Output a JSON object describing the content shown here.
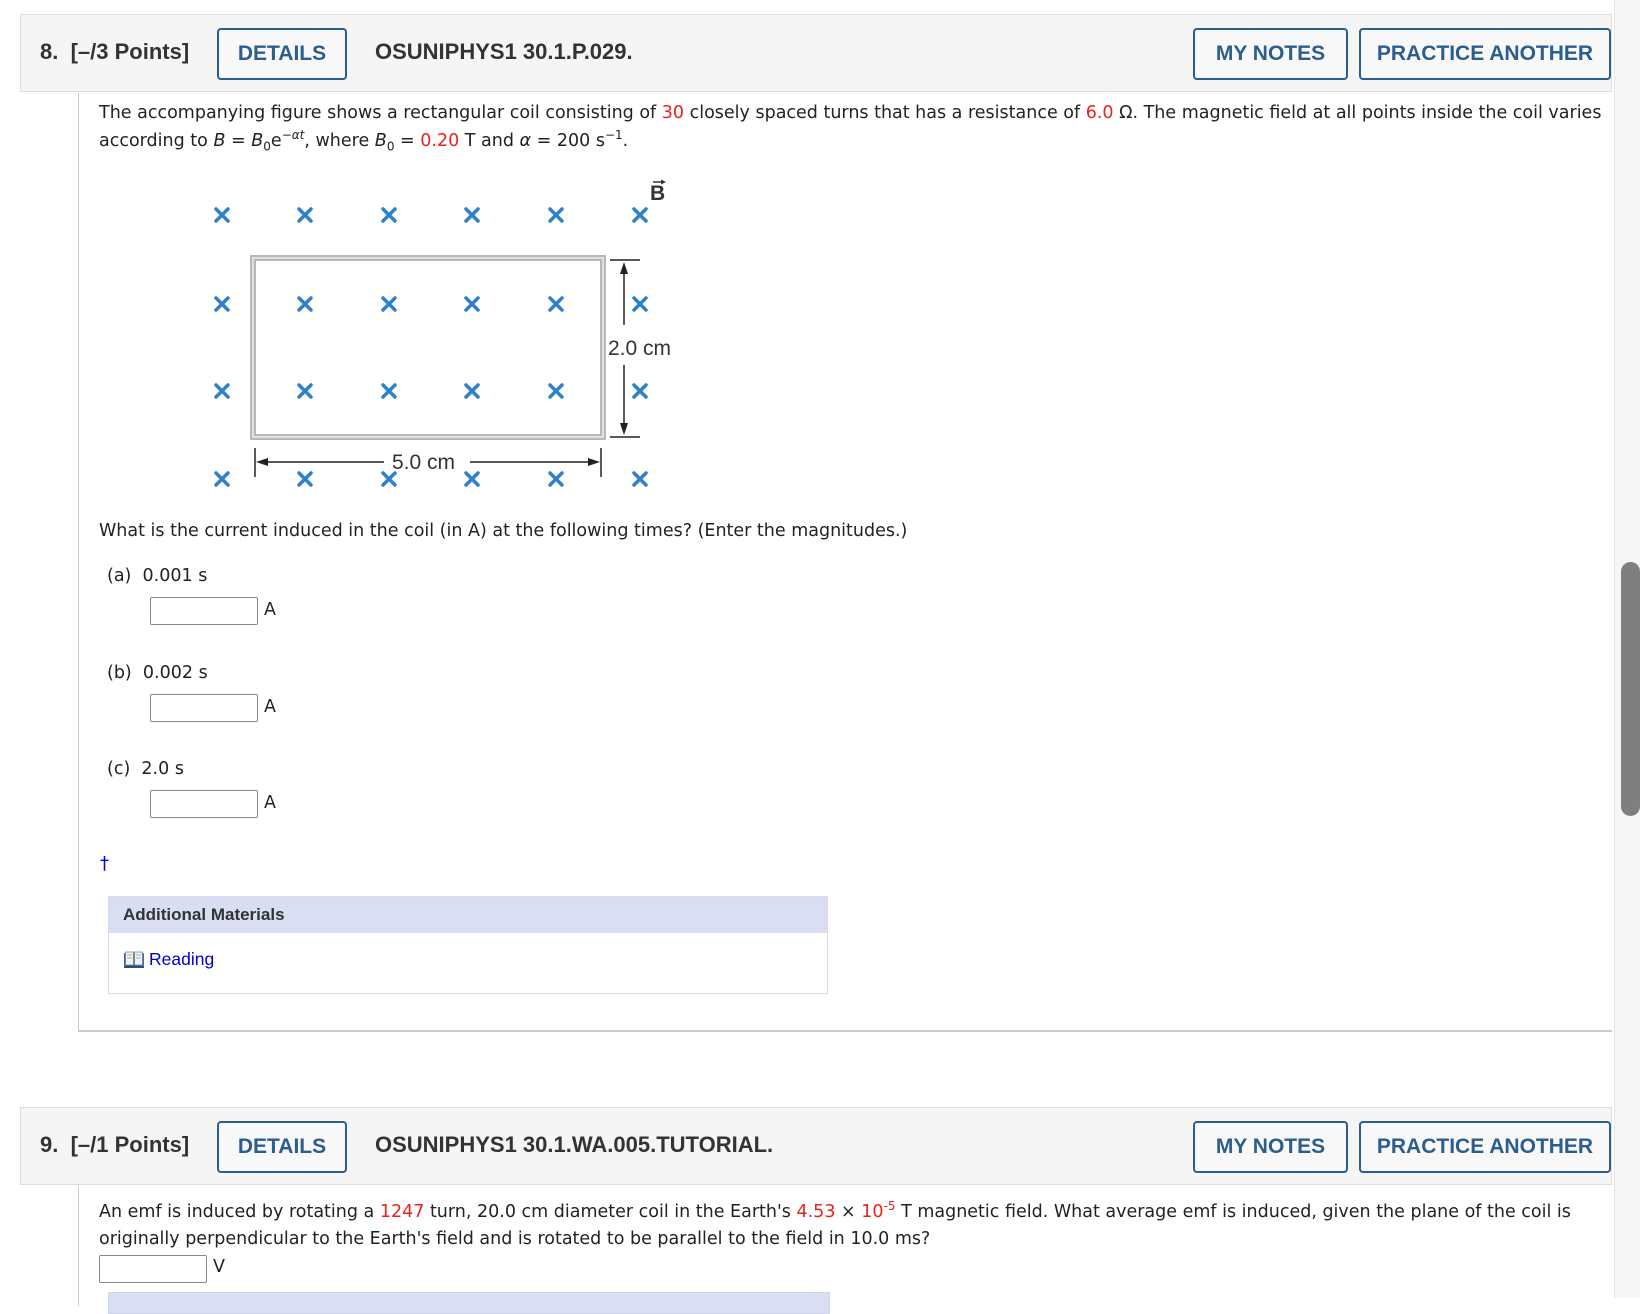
{
  "questions": [
    {
      "number": "8.",
      "points": "[–/3 Points]",
      "details_label": "DETAILS",
      "code": "OSUNIPHYS1 30.1.P.029.",
      "my_notes_label": "MY NOTES",
      "practice_label": "PRACTICE ANOTHER",
      "prompt": {
        "p1": "The accompanying figure shows a rectangular coil consisting of ",
        "turns": "30",
        "p2": " closely spaced turns that has a resistance of ",
        "resistance": "6.0",
        "p3": " Ω. The magnetic field at all points inside the coil varies",
        "l2a": "according to ",
        "B": "B",
        "eq": " = ",
        "B0": "B",
        "sub0": "0",
        "e": "e",
        "exp": "−αt",
        "l2b": ", where ",
        "B0b": "B",
        "sub0b": "0",
        "eq2": " = ",
        "b0_value": "0.20",
        "l2c": " T and ",
        "alpha": "α",
        "l2d": " = 200 s",
        "exp2": "−1",
        "l2e": "."
      },
      "figure": {
        "field_label": "B",
        "height_label": "2.0 cm",
        "width_label": "5.0 cm",
        "field_marker": "×",
        "marker_color": "#2f80c8"
      },
      "question": "What is the current induced in the coil (in A) at the following times? (Enter the magnitudes.)",
      "parts": [
        {
          "label": "(a)",
          "time": "0.001 s",
          "value": "",
          "unit": "A"
        },
        {
          "label": "(b)",
          "time": "0.002 s",
          "value": "",
          "unit": "A"
        },
        {
          "label": "(c)",
          "time": "2.0 s",
          "value": "",
          "unit": "A"
        }
      ],
      "dagger": "†",
      "additional_materials": {
        "title": "Additional Materials",
        "link_label": "Reading",
        "link_icon": "book-icon"
      }
    },
    {
      "number": "9.",
      "points": "[–/1 Points]",
      "details_label": "DETAILS",
      "code": "OSUNIPHYS1 30.1.WA.005.TUTORIAL.",
      "my_notes_label": "MY NOTES",
      "practice_label": "PRACTICE ANOTHER",
      "prompt": {
        "p1": "An emf is induced by rotating a ",
        "turns": "1247",
        "p2": " turn, 20.0 cm diameter coil in the Earth's ",
        "field_mantissa": "4.53",
        "times": " × ",
        "field_base": "10",
        "field_exp": "-5",
        "p3": " T magnetic field. What average emf is induced, given the plane of the coil is",
        "line2": "originally perpendicular to the Earth's field and is rotated to be parallel to the field in 10.0 ms?"
      },
      "answer": {
        "value": "",
        "unit": "V"
      }
    }
  ],
  "colors": {
    "accent": "#2b5e8c",
    "highlight": "#e8231e",
    "link": "#0000cc",
    "materials_header": "#d9def3"
  }
}
